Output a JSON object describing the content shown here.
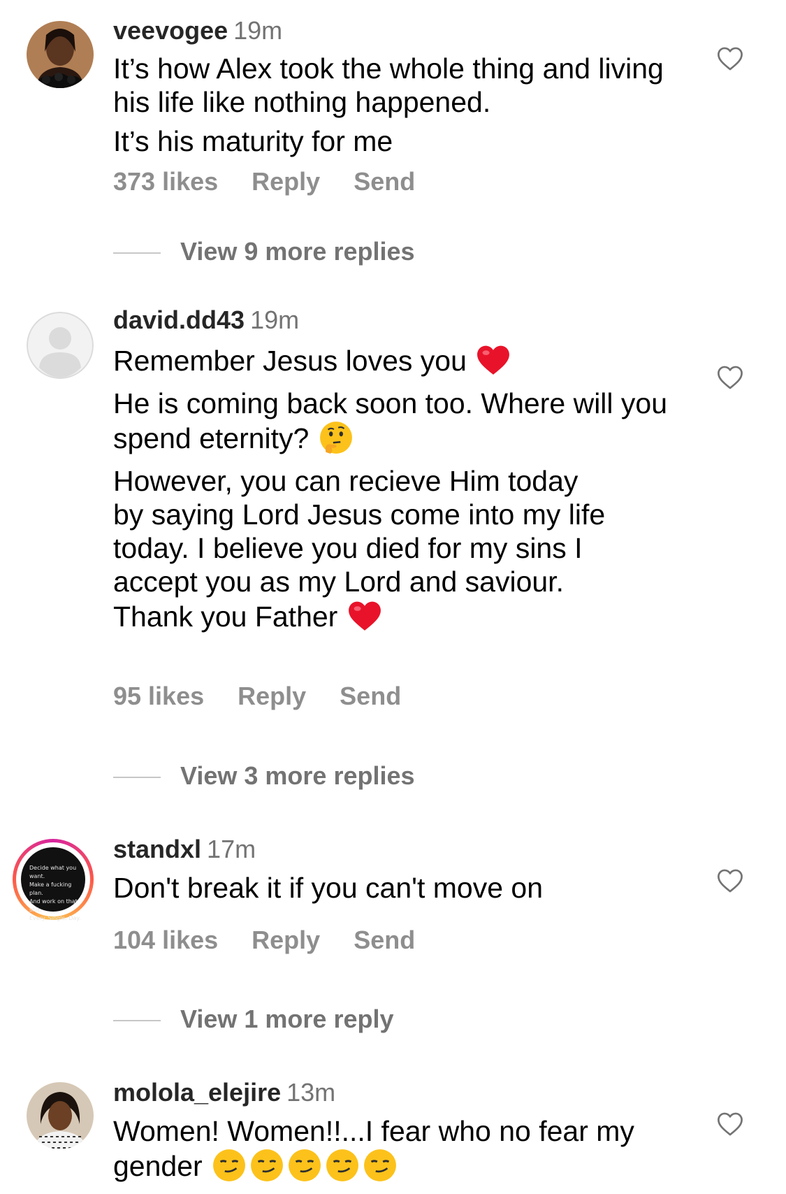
{
  "comments": [
    {
      "username": "veevogee",
      "time": "19m",
      "paragraphs": [
        "It’s how Alex took the whole thing and living his life like nothing happened.",
        "It’s his maturity for me"
      ],
      "likes": "373 likes",
      "reply": "Reply",
      "send": "Send",
      "view_replies": "View 9 more replies"
    },
    {
      "username": "david.dd43",
      "time": "19m",
      "p1": "Remember Jesus loves you",
      "p2": "He is coming back soon too. Where will you spend eternity?",
      "p3": "However, you can recieve Him today by saying Lord Jesus come into my life today. I believe you died for my sins I accept you as my Lord and saviour. Thank you Father",
      "likes": "95 likes",
      "reply": "Reply",
      "send": "Send",
      "view_replies": "View 3 more replies"
    },
    {
      "username": "standxl",
      "time": "17m",
      "avatar_text": "Decide what you want.\nMake a fucking plan.\nAnd work on that shit.\nEvery. Single. Day.",
      "paragraphs": [
        "Don't break it if you can't move on"
      ],
      "likes": "104 likes",
      "reply": "Reply",
      "send": "Send",
      "view_replies": "View 1 more reply"
    },
    {
      "username": "molola_elejire",
      "time": "13m",
      "text": "Women! Women!!...I fear who no fear my gender"
    }
  ],
  "icons": {
    "like": "heart-outline-icon",
    "red_heart": "red-heart-emoji",
    "thinking": "thinking-face-emoji",
    "smirk": "smirking-face-emoji"
  },
  "colors": {
    "username": "#262626",
    "timestamp": "#737373",
    "action_text": "#8e8e8e",
    "heart_emoji": "#e8132a",
    "story_ring_start": "#d6249f",
    "story_ring_end": "#fdc24d"
  }
}
